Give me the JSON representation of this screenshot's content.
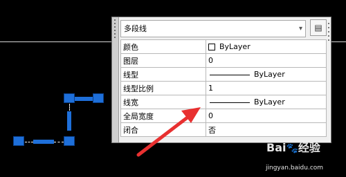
{
  "panel": {
    "selector_value": "多段线",
    "rows": [
      {
        "label": "颜色",
        "value": "ByLayer"
      },
      {
        "label": "图层",
        "value": "0"
      },
      {
        "label": "线型",
        "value": "ByLayer"
      },
      {
        "label": "线型比例",
        "value": "1"
      },
      {
        "label": "线宽",
        "value": "ByLayer"
      },
      {
        "label": "全局宽度",
        "value": "0"
      },
      {
        "label": "闭合",
        "value": "否"
      }
    ]
  },
  "watermark": {
    "brand": "Bai",
    "brand2": "经验",
    "url": "jingyan.baidu.com"
  },
  "colors": {
    "canvas": "#000000",
    "grip": "#1e6fd9",
    "arrow": "#e83030"
  }
}
